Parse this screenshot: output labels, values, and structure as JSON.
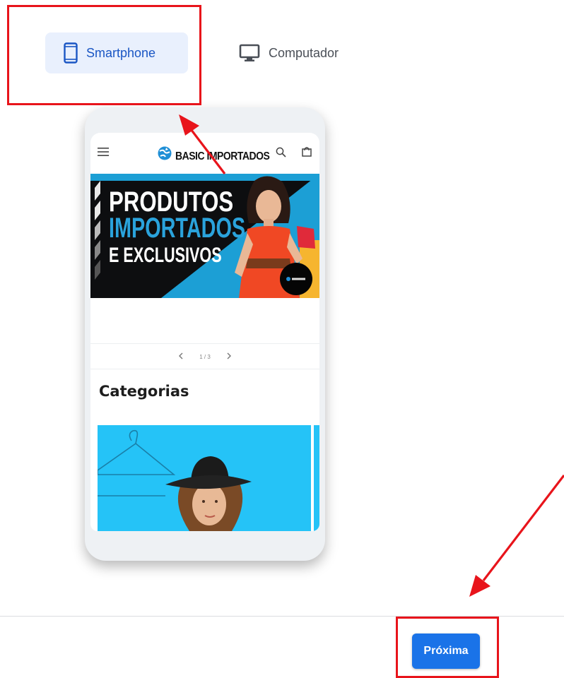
{
  "device_toggle": {
    "smartphone_label": "Smartphone",
    "computer_label": "Computador",
    "selected": "Smartphone",
    "active_color": "#1a56c4",
    "active_bg": "#e9f0fd"
  },
  "preview": {
    "store_name": "BASIC IMPORTADOS",
    "banner": {
      "line1": "PRODUTOS",
      "line2": "IMPORTADOS",
      "line3": "E EXCLUSIVOS"
    },
    "slider_counter": "1 / 3",
    "categories_title": "Categorias",
    "icons": [
      "menu-icon",
      "globe-logo-icon",
      "search-icon",
      "cart-icon",
      "chevron-left-icon",
      "chevron-right-icon"
    ]
  },
  "footer": {
    "next_label": "Próxima",
    "button_color": "#1a73e8"
  },
  "annotation": {
    "color": "#e8141b"
  }
}
